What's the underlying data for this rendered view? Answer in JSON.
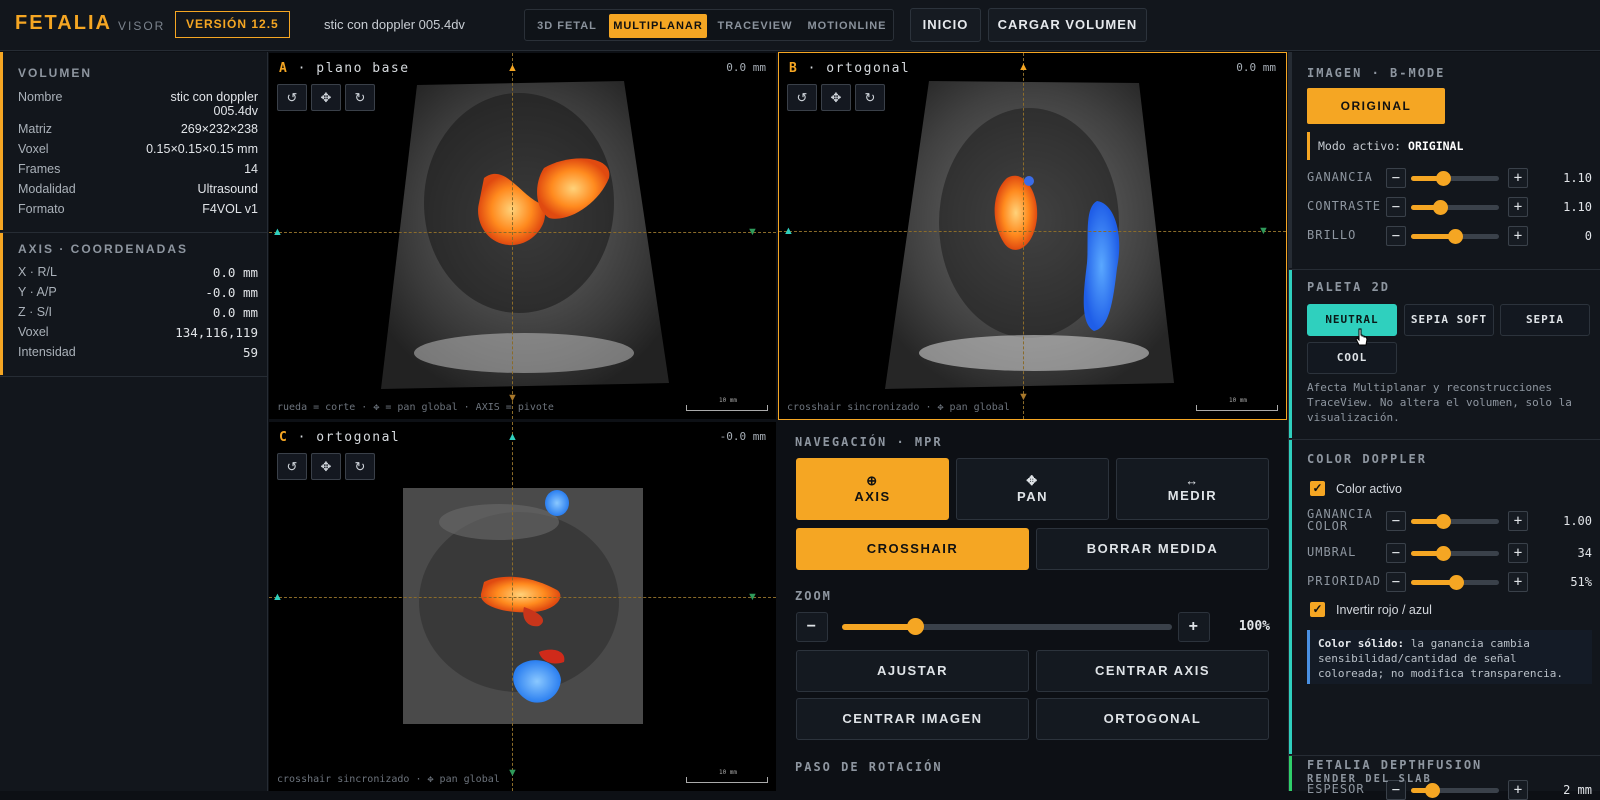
{
  "header": {
    "brand": "FETALIA",
    "brand_sub": "VISOR",
    "version": "VERSIÓN 12.5",
    "file_name": "stic con doppler 005.4dv",
    "modes": [
      {
        "label": "3D FETAL",
        "active": false
      },
      {
        "label": "MULTIPLANAR",
        "active": true
      },
      {
        "label": "TRACEVIEW",
        "active": false
      },
      {
        "label": "MOTIONLINE",
        "active": false
      }
    ],
    "inicio": "INICIO",
    "cargar": "CARGAR VOLUMEN"
  },
  "volumen": {
    "title": "VOLUMEN",
    "rows": [
      {
        "label": "Nombre",
        "value": "stic con doppler 005.4dv"
      },
      {
        "label": "Matriz",
        "value": "269×232×238"
      },
      {
        "label": "Voxel",
        "value": "0.15×0.15×0.15 mm"
      },
      {
        "label": "Frames",
        "value": "14"
      },
      {
        "label": "Modalidad",
        "value": "Ultrasound"
      },
      {
        "label": "Formato",
        "value": "F4VOL v1"
      }
    ]
  },
  "axis": {
    "title": "AXIS · COORDENADAS",
    "rows": [
      {
        "label": "X · R/L",
        "value": "0.0 mm"
      },
      {
        "label": "Y · A/P",
        "value": "-0.0 mm"
      },
      {
        "label": "Z · S/I",
        "value": "0.0 mm"
      },
      {
        "label": "Voxel",
        "value": "134,116,119"
      },
      {
        "label": "Intensidad",
        "value": "59"
      }
    ]
  },
  "viewports": [
    {
      "letter": "A",
      "name": " · plano base",
      "depth": "0.0 mm",
      "hint": "rueda = corte · ✥ = pan global · AXIS = pivote",
      "scale": "10 mm"
    },
    {
      "letter": "B",
      "name": " · ortogonal",
      "depth": "0.0 mm",
      "hint": "crosshair sincronizado · ✥ pan global",
      "scale": "10 mm"
    },
    {
      "letter": "C",
      "name": " · ortogonal",
      "depth": "-0.0 mm",
      "hint": "crosshair sincronizado · ✥ pan global",
      "scale": "10 mm"
    }
  ],
  "viewport_buttons": {
    "rotate_left": "↺",
    "pan": "✥",
    "rotate_right": "↻"
  },
  "navegacion": {
    "title": "NAVEGACIÓN · MPR",
    "axis_icon": "⊕",
    "axis": "AXIS",
    "pan_icon": "✥",
    "pan": "PAN",
    "medir_icon": "↔",
    "medir": "MEDIR",
    "crosshair": "CROSSHAIR",
    "borrar": "BORRAR MEDIDA"
  },
  "zoom": {
    "title": "ZOOM",
    "minus": "−",
    "plus": "+",
    "value": "100%",
    "level": 0.22
  },
  "actions": {
    "ajustar": "AJUSTAR",
    "centrar_axis": "CENTRAR AXIS",
    "centrar_imagen": "CENTRAR IMAGEN",
    "ortogonal": "ORTOGONAL"
  },
  "paso": {
    "title": "PASO DE ROTACIÓN"
  },
  "imagen": {
    "title": "IMAGEN · B-MODE",
    "original_btn": "ORIGINAL",
    "modo_label": "Modo activo: ",
    "modo_value": "ORIGINAL",
    "sliders": [
      {
        "label": "GANANCIA",
        "value": "1.10",
        "level": 0.36
      },
      {
        "label": "CONTRASTE",
        "value": "1.10",
        "level": 0.33
      },
      {
        "label": "BRILLO",
        "value": "0",
        "level": 0.5
      }
    ]
  },
  "paleta": {
    "title": "PALETA 2D",
    "options": [
      {
        "label": "NEUTRAL",
        "active": true
      },
      {
        "label": "SEPIA SOFT",
        "active": false
      },
      {
        "label": "SEPIA",
        "active": false
      },
      {
        "label": "COOL",
        "active": false
      }
    ],
    "note": "Afecta Multiplanar y reconstrucciones TraceView. No altera el volumen, solo la visualización."
  },
  "doppler": {
    "title": "COLOR DOPPLER",
    "color_activo": "Color activo",
    "sliders": [
      {
        "label": "GANANCIA COLOR",
        "value": "1.00",
        "level": 0.36
      },
      {
        "label": "UMBRAL",
        "value": "34",
        "level": 0.36
      },
      {
        "label": "PRIORIDAD",
        "value": "51%",
        "level": 0.51
      }
    ],
    "invertir": "Invertir rojo / azul",
    "note_bold": "Color sólido:",
    "note": " la ganancia cambia sensibilidad/cantidad de señal coloreada; no modifica transparencia."
  },
  "depthfusion": {
    "title": "FETALIA DEPTHFUSION",
    "espesor_label": "ESPESOR",
    "espesor_value": "2 mm",
    "espesor_level": 0.24,
    "render": "RENDER DEL SLAB"
  },
  "colors": {
    "accent": "#f5a623",
    "teal": "#2fd0be",
    "doppler_blue": "#2f7cf5"
  }
}
